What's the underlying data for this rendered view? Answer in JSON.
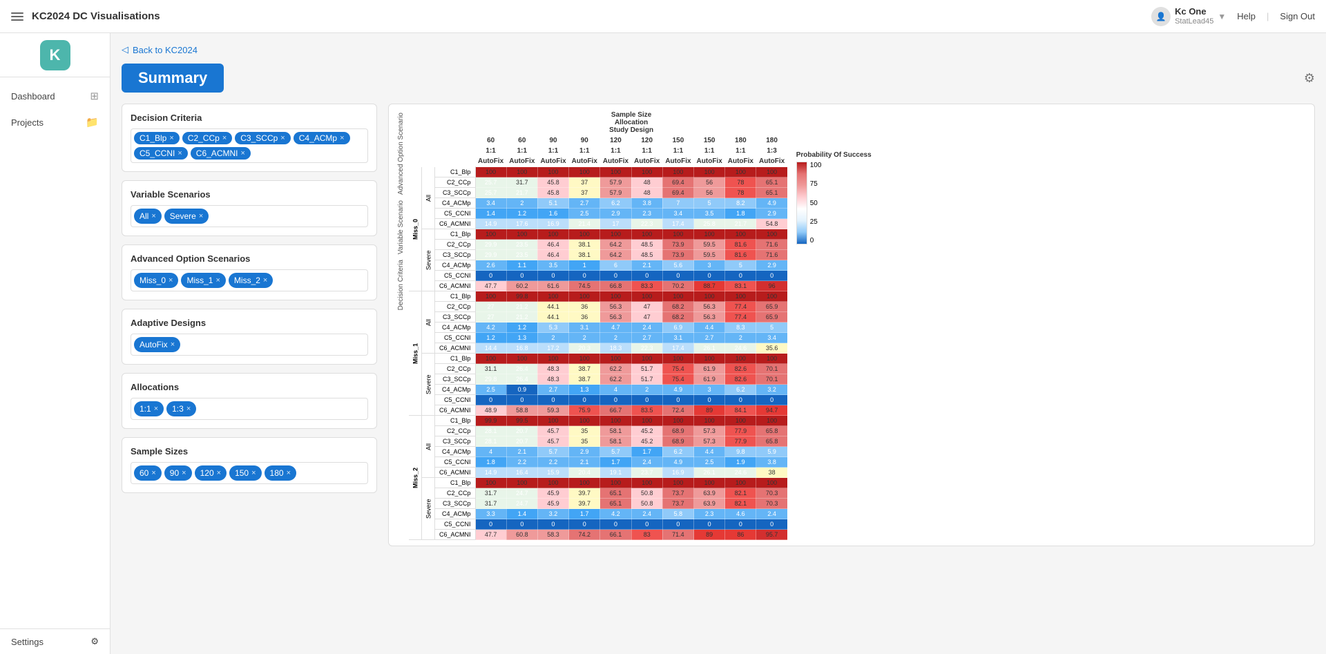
{
  "app": {
    "title": "KC2024 DC Visualisations"
  },
  "topbar": {
    "menu_icon": "≡",
    "title": "KC2024 DC Visualisations",
    "user_name": "Kc One",
    "user_role": "StatLead45",
    "help_label": "Help",
    "signout_label": "Sign Out"
  },
  "sidebar": {
    "logo": "K",
    "items": [
      {
        "label": "Dashboard",
        "icon": "⊞"
      },
      {
        "label": "Projects",
        "icon": "📁"
      }
    ],
    "settings_label": "Settings",
    "settings_icon": "⚙"
  },
  "page": {
    "back_label": "Back to KC2024",
    "title": "Summary"
  },
  "decision_criteria": {
    "title": "Decision Criteria",
    "tags": [
      "C1_Blp",
      "C2_CCp",
      "C3_SCCp",
      "C4_ACMp",
      "C5_CCNI",
      "C6_ACMNI"
    ]
  },
  "variable_scenarios": {
    "title": "Variable Scenarios",
    "tags": [
      "All",
      "Severe"
    ]
  },
  "advanced_option_scenarios": {
    "title": "Advanced Option Scenarios",
    "tags": [
      "Miss_0",
      "Miss_1",
      "Miss_2"
    ]
  },
  "adaptive_designs": {
    "title": "Adaptive Designs",
    "tags": [
      "AutoFix"
    ]
  },
  "allocations": {
    "title": "Allocations",
    "tags": [
      "1:1",
      "1:3"
    ]
  },
  "sample_sizes": {
    "title": "Sample Sizes",
    "tags": [
      "60",
      "90",
      "120",
      "150",
      "180"
    ]
  },
  "heatmap": {
    "header_group": "Sample Size\nAllocation\nStudy Design",
    "col_sizes": [
      "60",
      "60",
      "90",
      "90",
      "120",
      "120",
      "150",
      "150",
      "180",
      "180"
    ],
    "col_allocs": [
      "1:1",
      "1:1",
      "1:1",
      "1:1",
      "1:1",
      "1:1",
      "1:1",
      "1:1",
      "1:1",
      "1:3"
    ],
    "col_designs": [
      "AutoFix",
      "AutoFix",
      "AutoFix",
      "AutoFix",
      "AutoFix",
      "AutoFix",
      "AutoFix",
      "AutoFix",
      "AutoFix",
      "AutoFix"
    ],
    "legend": {
      "title": "Probability Of Success",
      "values": [
        "100",
        "75",
        "50",
        "25",
        "0"
      ]
    },
    "rows": [
      {
        "miss": "Miss_0",
        "var": "All",
        "criteria": "C1_Blp",
        "values": [
          100,
          100,
          100,
          100,
          100,
          100,
          100,
          100,
          100,
          100
        ]
      },
      {
        "miss": "Miss_0",
        "var": "All",
        "criteria": "C2_CCp",
        "values": [
          25.7,
          31.7,
          45.8,
          37,
          57.9,
          48,
          69.4,
          56,
          78,
          65.1
        ]
      },
      {
        "miss": "Miss_0",
        "var": "All",
        "criteria": "C3_SCCp",
        "values": [
          25.7,
          21.7,
          45.8,
          37,
          57.9,
          48,
          69.4,
          56,
          78,
          65.1
        ]
      },
      {
        "miss": "Miss_0",
        "var": "All",
        "criteria": "C4_ACMp",
        "values": [
          3.4,
          2,
          5.1,
          2.7,
          6.2,
          3.8,
          7,
          5,
          8.2,
          4.9
        ]
      },
      {
        "miss": "Miss_0",
        "var": "All",
        "criteria": "C5_CCNI",
        "values": [
          1.4,
          1.2,
          1.6,
          2.5,
          2.9,
          2.3,
          3.4,
          3.5,
          1.8,
          2.9
        ]
      },
      {
        "miss": "Miss_0",
        "var": "All",
        "criteria": "C6_ACMNI",
        "values": [
          14.9,
          17.6,
          16.9,
          21.4,
          17,
          22.3,
          17.4,
          25.8,
          21.7,
          54.8
        ]
      },
      {
        "miss": "Miss_0",
        "var": "Severe",
        "criteria": "C1_Blp",
        "values": [
          100,
          100,
          100,
          100,
          100,
          100,
          100,
          100,
          100,
          100
        ]
      },
      {
        "miss": "Miss_0",
        "var": "Severe",
        "criteria": "C2_CCp",
        "values": [
          29.9,
          23.5,
          46.4,
          38.1,
          64.2,
          48.5,
          73.9,
          59.5,
          81.6,
          71.6
        ]
      },
      {
        "miss": "Miss_0",
        "var": "Severe",
        "criteria": "C3_SCCp",
        "values": [
          29.9,
          23.5,
          46.4,
          38.1,
          64.2,
          48.5,
          73.9,
          59.5,
          81.6,
          71.6
        ]
      },
      {
        "miss": "Miss_0",
        "var": "Severe",
        "criteria": "C4_ACMp",
        "values": [
          2.6,
          1.1,
          3.5,
          1,
          6,
          2.1,
          5.6,
          3,
          5,
          2.9
        ]
      },
      {
        "miss": "Miss_0",
        "var": "Severe",
        "criteria": "C5_CCNI",
        "values": [
          0,
          0,
          0,
          0,
          0,
          0,
          0,
          0,
          0,
          0
        ]
      },
      {
        "miss": "Miss_0",
        "var": "Severe",
        "criteria": "C6_ACMNI",
        "values": [
          47.7,
          60.2,
          61.6,
          74.5,
          66.8,
          83.3,
          70.2,
          88.7,
          83.1,
          96
        ]
      },
      {
        "miss": "Miss_1",
        "var": "All",
        "criteria": "C1_Blp",
        "values": [
          100,
          99.8,
          100,
          100,
          100,
          100,
          100,
          100,
          100,
          100
        ]
      },
      {
        "miss": "Miss_1",
        "var": "All",
        "criteria": "C2_CCp",
        "values": [
          27,
          21.2,
          44.1,
          36,
          56.3,
          47,
          68.2,
          56.3,
          77.4,
          65.9
        ]
      },
      {
        "miss": "Miss_1",
        "var": "All",
        "criteria": "C3_SCCp",
        "values": [
          27,
          21.2,
          44.1,
          36,
          56.3,
          47,
          68.2,
          56.3,
          77.4,
          65.9
        ]
      },
      {
        "miss": "Miss_1",
        "var": "All",
        "criteria": "C4_ACMp",
        "values": [
          4.2,
          1.2,
          5.3,
          3.1,
          4.7,
          2.4,
          6.9,
          4.4,
          8.3,
          5
        ]
      },
      {
        "miss": "Miss_1",
        "var": "All",
        "criteria": "C5_CCNI",
        "values": [
          1.2,
          1.3,
          2,
          2,
          2,
          2.7,
          3.1,
          2.7,
          2,
          3.4
        ]
      },
      {
        "miss": "Miss_1",
        "var": "All",
        "criteria": "C6_ACMNI",
        "values": [
          14.4,
          16.8,
          17.2,
          20.3,
          18.3,
          22.3,
          17.4,
          26.1,
          24.6,
          35.6
        ]
      },
      {
        "miss": "Miss_1",
        "var": "Severe",
        "criteria": "C1_Blp",
        "values": [
          100,
          100,
          100,
          100,
          100,
          100,
          100,
          100,
          100,
          100
        ]
      },
      {
        "miss": "Miss_1",
        "var": "Severe",
        "criteria": "C2_CCp",
        "values": [
          31.1,
          26.4,
          48.3,
          38.7,
          62.2,
          51.7,
          75.4,
          61.9,
          82.6,
          70.1
        ]
      },
      {
        "miss": "Miss_1",
        "var": "Severe",
        "criteria": "C3_SCCp",
        "values": [
          29.8,
          26.4,
          48.3,
          38.7,
          62.2,
          51.7,
          75.4,
          61.9,
          82.6,
          70.1
        ]
      },
      {
        "miss": "Miss_1",
        "var": "Severe",
        "criteria": "C4_ACMp",
        "values": [
          2.5,
          0.9,
          2.7,
          1.3,
          4,
          2,
          4.9,
          3,
          6.2,
          3.2
        ]
      },
      {
        "miss": "Miss_1",
        "var": "Severe",
        "criteria": "C5_CCNI",
        "values": [
          0,
          0,
          0,
          0,
          0,
          0,
          0,
          0,
          0,
          0
        ]
      },
      {
        "miss": "Miss_1",
        "var": "Severe",
        "criteria": "C6_ACMNI",
        "values": [
          48.9,
          58.8,
          59.3,
          75.9,
          66.7,
          83.5,
          72.4,
          89,
          84.1,
          94.7
        ]
      },
      {
        "miss": "Miss_2",
        "var": "All",
        "criteria": "C1_Blp",
        "values": [
          99.9,
          99.5,
          100,
          100,
          100,
          100,
          100,
          100,
          100,
          100
        ]
      },
      {
        "miss": "Miss_2",
        "var": "All",
        "criteria": "C2_CCp",
        "values": [
          28.1,
          20.7,
          45.7,
          35,
          58.1,
          45.2,
          68.9,
          57.3,
          77.9,
          65.8
        ]
      },
      {
        "miss": "Miss_2",
        "var": "All",
        "criteria": "C3_SCCp",
        "values": [
          28.1,
          20.7,
          45.7,
          35,
          58.1,
          45.2,
          68.9,
          57.3,
          77.9,
          65.8
        ]
      },
      {
        "miss": "Miss_2",
        "var": "All",
        "criteria": "C4_ACMp",
        "values": [
          4,
          2.1,
          5.7,
          2.9,
          5.7,
          1.7,
          6.2,
          4.4,
          9.8,
          5.9
        ]
      },
      {
        "miss": "Miss_2",
        "var": "All",
        "criteria": "C5_CCNI",
        "values": [
          1.8,
          2.2,
          2.2,
          2.1,
          1.7,
          2.4,
          4.9,
          2.5,
          1.9,
          3.8
        ]
      },
      {
        "miss": "Miss_2",
        "var": "All",
        "criteria": "C6_ACMNI",
        "values": [
          14.9,
          16.4,
          15.9,
          20.4,
          19.1,
          23.7,
          16.9,
          26.1,
          24.6,
          38
        ]
      },
      {
        "miss": "Miss_2",
        "var": "Severe",
        "criteria": "C1_Blp",
        "values": [
          100,
          100,
          100,
          100,
          100,
          100,
          100,
          100,
          100,
          100
        ]
      },
      {
        "miss": "Miss_2",
        "var": "Severe",
        "criteria": "C2_CCp",
        "values": [
          31.7,
          24.7,
          45.9,
          39.7,
          65.1,
          50.8,
          73.7,
          63.9,
          82.1,
          70.3
        ]
      },
      {
        "miss": "Miss_2",
        "var": "Severe",
        "criteria": "C3_SCCp",
        "values": [
          31.7,
          24.7,
          45.9,
          39.7,
          65.1,
          50.8,
          73.7,
          63.9,
          82.1,
          70.3
        ]
      },
      {
        "miss": "Miss_2",
        "var": "Severe",
        "criteria": "C4_ACMp",
        "values": [
          3.3,
          1.4,
          3.2,
          1.7,
          4.2,
          2.4,
          5.8,
          2.3,
          4.6,
          2.4
        ]
      },
      {
        "miss": "Miss_2",
        "var": "Severe",
        "criteria": "C5_CCNI",
        "values": [
          0,
          0,
          0,
          0,
          0,
          0,
          0,
          0,
          0,
          0
        ]
      },
      {
        "miss": "Miss_2",
        "var": "Severe",
        "criteria": "C6_ACMNI",
        "values": [
          47.7,
          60.8,
          58.3,
          74.2,
          66.1,
          83,
          71.4,
          89,
          86,
          95.7
        ]
      }
    ]
  }
}
